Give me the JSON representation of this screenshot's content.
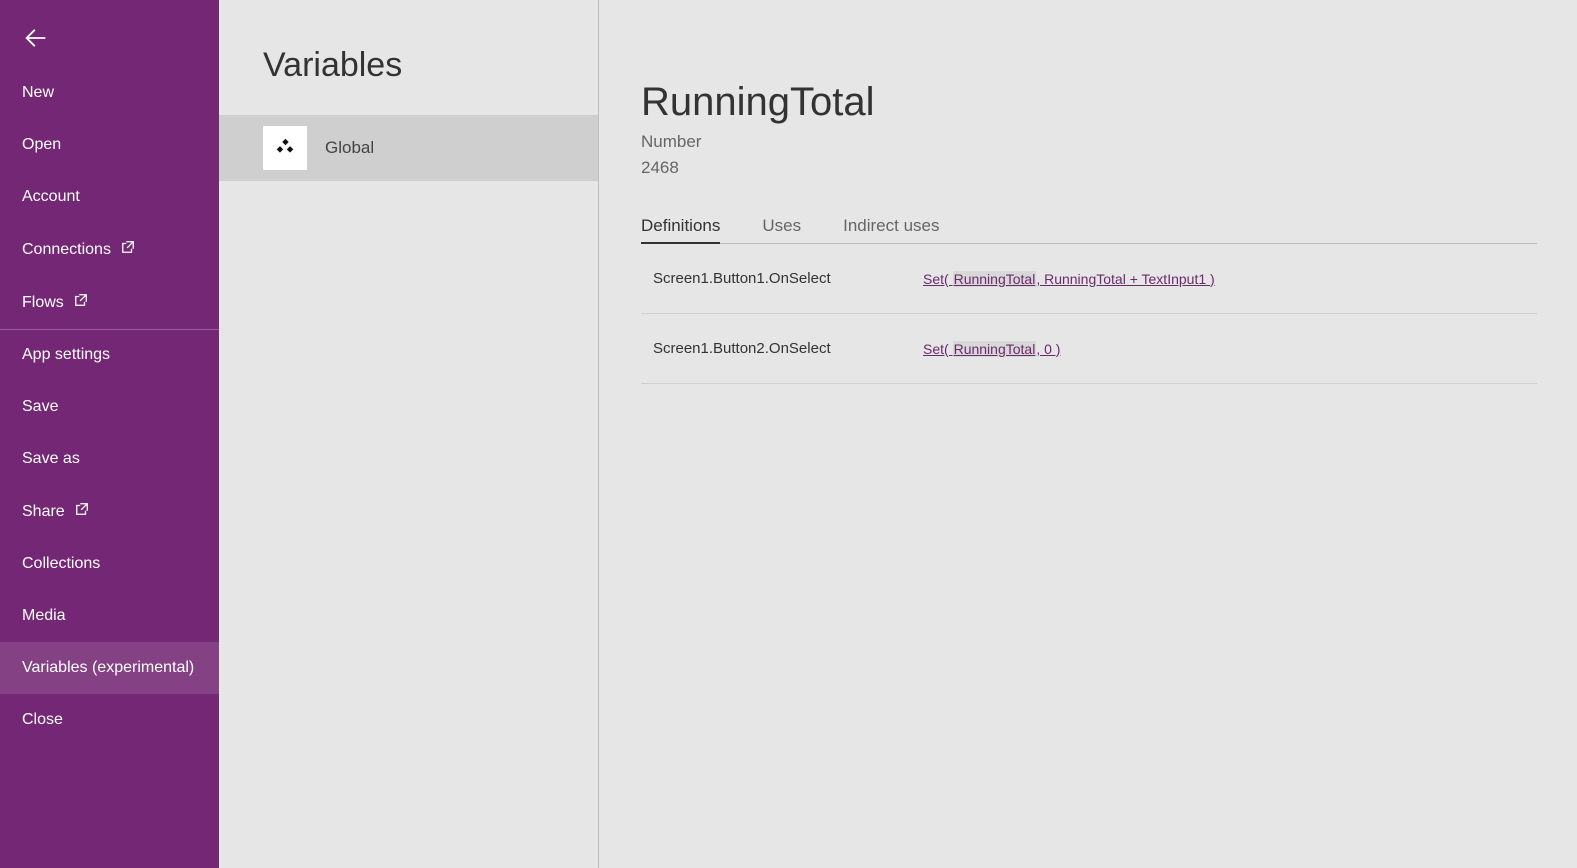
{
  "nav": [
    {
      "label": "New",
      "ext": false
    },
    {
      "label": "Open",
      "ext": false
    },
    {
      "label": "Account",
      "ext": false
    },
    {
      "label": "Connections",
      "ext": true
    },
    {
      "label": "Flows",
      "ext": true,
      "divider": true
    },
    {
      "label": "App settings",
      "ext": false
    },
    {
      "label": "Save",
      "ext": false
    },
    {
      "label": "Save as",
      "ext": false
    },
    {
      "label": "Share",
      "ext": true
    },
    {
      "label": "Collections",
      "ext": false
    },
    {
      "label": "Media",
      "ext": false
    },
    {
      "label": "Variables (experimental)",
      "ext": false,
      "selected": true
    },
    {
      "label": "Close",
      "ext": false
    }
  ],
  "scope_title": "Variables",
  "scope_item_label": "Global",
  "variable": {
    "name": "RunningTotal",
    "type": "Number",
    "value": "2468"
  },
  "tabs": {
    "definitions": "Definitions",
    "uses": "Uses",
    "indirect": "Indirect uses"
  },
  "definitions": [
    {
      "where": "Screen1.Button1.OnSelect",
      "formula_prefix": "Set( ",
      "formula_hl": "RunningTotal",
      "formula_suffix": ", RunningTotal + TextInput1 )"
    },
    {
      "where": "Screen1.Button2.OnSelect",
      "formula_prefix": "Set( ",
      "formula_hl": "RunningTotal",
      "formula_suffix": ", 0 )"
    }
  ]
}
